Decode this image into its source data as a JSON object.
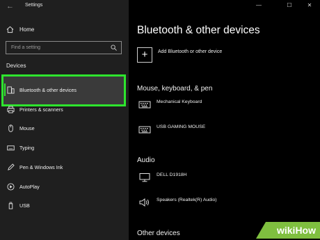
{
  "window": {
    "title": "Settings",
    "back_glyph": "←",
    "controls": {
      "minimize": "—",
      "maximize": "☐",
      "close": "✕"
    }
  },
  "sidebar": {
    "home_label": "Home",
    "search_placeholder": "Find a setting",
    "section_heading": "Devices",
    "items": [
      {
        "label": "Bluetooth & other devices",
        "icon": "bluetooth-devices-icon",
        "active": true
      },
      {
        "label": "Printers & scanners",
        "icon": "printer-icon"
      },
      {
        "label": "Mouse",
        "icon": "mouse-icon"
      },
      {
        "label": "Typing",
        "icon": "keyboard-icon"
      },
      {
        "label": "Pen & Windows Ink",
        "icon": "pen-icon"
      },
      {
        "label": "AutoPlay",
        "icon": "autoplay-icon"
      },
      {
        "label": "USB",
        "icon": "usb-icon"
      }
    ]
  },
  "main": {
    "title": "Bluetooth & other devices",
    "add_device_label": "Add Bluetooth or other device",
    "sections": {
      "mouse_keyboard_pen": {
        "title": "Mouse, keyboard, & pen",
        "devices": [
          {
            "name": "Mechanical Keyboard",
            "icon": "keyboard-icon"
          },
          {
            "name": "USB GAMING MOUSE",
            "icon": "keyboard-icon"
          }
        ]
      },
      "audio": {
        "title": "Audio",
        "devices": [
          {
            "name": "DELL D1918H",
            "icon": "monitor-icon"
          },
          {
            "name": "Speakers (Realtek(R) Audio)",
            "icon": "speaker-icon"
          }
        ]
      },
      "other": {
        "title": "Other devices"
      }
    }
  },
  "watermark": {
    "prefix": "wiki",
    "suffix": "How",
    "accent_color": "#7fbf3f"
  },
  "colors": {
    "highlight": "#2ee52e",
    "sidebar_bg": "#1f1f1f",
    "main_bg": "#000000"
  }
}
